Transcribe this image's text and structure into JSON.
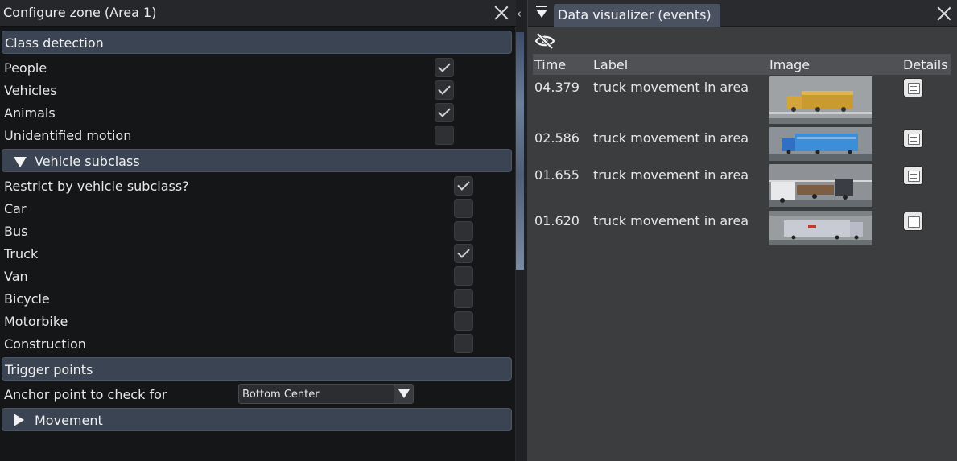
{
  "left_panel": {
    "title": "Configure zone (Area 1)",
    "sections": {
      "class_detection": "Class detection",
      "vehicle_subclass": "Vehicle subclass",
      "trigger_points": "Trigger points",
      "movement": "Movement"
    },
    "class_items": [
      {
        "label": "People",
        "checked": true
      },
      {
        "label": "Vehicles",
        "checked": true
      },
      {
        "label": "Animals",
        "checked": true
      },
      {
        "label": "Unidentified motion",
        "checked": false
      }
    ],
    "subclass_items": [
      {
        "label": "Restrict by vehicle subclass?",
        "checked": true
      },
      {
        "label": "Car",
        "checked": false
      },
      {
        "label": "Bus",
        "checked": false
      },
      {
        "label": "Truck",
        "checked": true
      },
      {
        "label": "Van",
        "checked": false
      },
      {
        "label": "Bicycle",
        "checked": false
      },
      {
        "label": "Motorbike",
        "checked": false
      },
      {
        "label": "Construction",
        "checked": false
      }
    ],
    "anchor": {
      "label": "Anchor point to check for",
      "value": "Bottom Center"
    }
  },
  "right_panel": {
    "tab_title": "Data visualizer (events)",
    "columns": {
      "time": "Time",
      "label": "Label",
      "image": "Image",
      "details": "Details"
    },
    "rows": [
      {
        "time": "04.379",
        "label": "truck movement in area"
      },
      {
        "time": "02.586",
        "label": "truck movement in area"
      },
      {
        "time": "01.655",
        "label": "truck movement in area"
      },
      {
        "time": "01.620",
        "label": "truck movement in area"
      }
    ]
  },
  "icons": [
    "close-icon",
    "eye-off-icon",
    "document-icon",
    "menu-icon",
    "chevron-left-icon"
  ],
  "colors": {
    "section_header": "#3a4452",
    "panel_bg": "#151618",
    "right_bg": "#3c3d3f",
    "tab": "#4a5160"
  }
}
